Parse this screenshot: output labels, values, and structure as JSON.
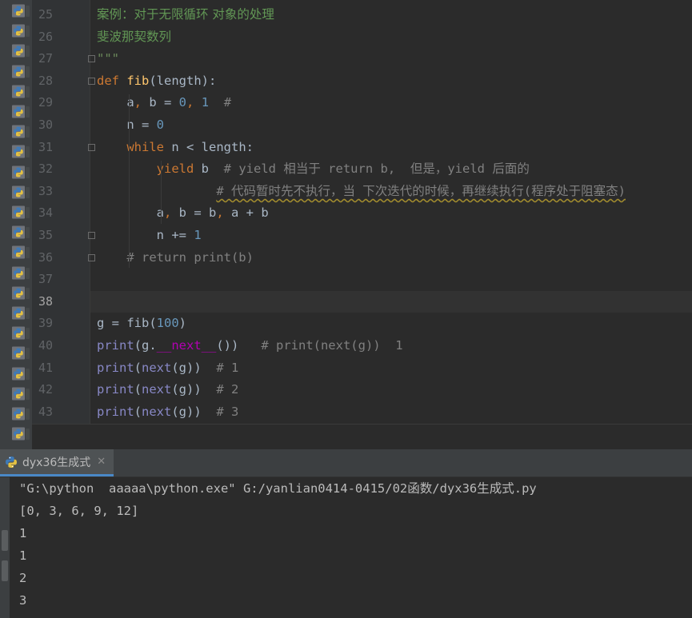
{
  "colors": {
    "editor_bg": "#2b2b2b",
    "gutter_bg": "#313335",
    "keyword": "#cc7832",
    "function": "#ffc66d",
    "number": "#6897bb",
    "comment": "#808080",
    "docstring": "#629755",
    "builtin": "#8888c6",
    "dunder": "#b200b2",
    "text": "#a9b7c6",
    "tab_underline": "#4a88c7"
  },
  "project_panel": {
    "file_icon": "python-file-icon",
    "file_count": 22
  },
  "editor": {
    "current_line": 38,
    "lines": [
      {
        "n": "25",
        "tokens": [
          {
            "c": "t-zh-doc",
            "t": "案例：对于无限循环 对象的处理"
          }
        ]
      },
      {
        "n": "26",
        "tokens": [
          {
            "c": "t-zh-doc",
            "t": "斐波那契数列"
          }
        ]
      },
      {
        "n": "27",
        "tokens": [
          {
            "c": "t-str",
            "t": "\"\"\""
          }
        ]
      },
      {
        "n": "28",
        "tokens": [
          {
            "c": "t-kw",
            "t": "def "
          },
          {
            "c": "t-fn",
            "t": "fib"
          },
          {
            "c": "t-txt",
            "t": "(length):"
          }
        ]
      },
      {
        "n": "29",
        "tokens": [
          {
            "c": "t-txt",
            "t": "    a"
          },
          {
            "c": "t-pun",
            "t": ", "
          },
          {
            "c": "t-txt",
            "t": "b = "
          },
          {
            "c": "t-num",
            "t": "0"
          },
          {
            "c": "t-pun",
            "t": ", "
          },
          {
            "c": "t-num",
            "t": "1"
          },
          {
            "c": "t-cm",
            "t": "  #"
          }
        ]
      },
      {
        "n": "30",
        "tokens": [
          {
            "c": "t-txt",
            "t": "    n = "
          },
          {
            "c": "t-num",
            "t": "0"
          }
        ]
      },
      {
        "n": "31",
        "tokens": [
          {
            "c": "t-txt",
            "t": "    "
          },
          {
            "c": "t-kw",
            "t": "while "
          },
          {
            "c": "t-txt",
            "t": "n < length:"
          }
        ]
      },
      {
        "n": "32",
        "tokens": [
          {
            "c": "t-txt",
            "t": "        "
          },
          {
            "c": "t-kw",
            "t": "yield "
          },
          {
            "c": "t-txt",
            "t": "b"
          },
          {
            "c": "t-cm",
            "t": "  # yield "
          },
          {
            "c": "t-cmz",
            "t": "相当于"
          },
          {
            "c": "t-cm",
            "t": " return b,  "
          },
          {
            "c": "t-cmz",
            "t": "但是，"
          },
          {
            "c": "t-cm",
            "t": "yield "
          },
          {
            "c": "t-cmz",
            "t": "后面的"
          }
        ]
      },
      {
        "n": "33",
        "tokens": [
          {
            "c": "t-txt",
            "t": "                "
          },
          {
            "c": "t-cmz warn-underline",
            "t": "# 代码暂时先不执行，当 下次迭代的时候，再继续执行(程序处于阻塞态)"
          }
        ]
      },
      {
        "n": "34",
        "tokens": [
          {
            "c": "t-txt",
            "t": "        a"
          },
          {
            "c": "t-pun",
            "t": ", "
          },
          {
            "c": "t-txt",
            "t": "b = b"
          },
          {
            "c": "t-pun",
            "t": ", "
          },
          {
            "c": "t-txt",
            "t": "a + b"
          }
        ]
      },
      {
        "n": "35",
        "tokens": [
          {
            "c": "t-txt",
            "t": "        n += "
          },
          {
            "c": "t-num",
            "t": "1"
          }
        ]
      },
      {
        "n": "36",
        "tokens": [
          {
            "c": "t-cm",
            "t": "    # return print(b)"
          }
        ]
      },
      {
        "n": "37",
        "tokens": []
      },
      {
        "n": "38",
        "tokens": []
      },
      {
        "n": "39",
        "tokens": [
          {
            "c": "t-txt",
            "t": "g = fib("
          },
          {
            "c": "t-num",
            "t": "100"
          },
          {
            "c": "t-txt",
            "t": ")"
          }
        ]
      },
      {
        "n": "40",
        "tokens": [
          {
            "c": "t-bi",
            "t": "print"
          },
          {
            "c": "t-txt",
            "t": "(g."
          },
          {
            "c": "t-dunder",
            "t": "__next__"
          },
          {
            "c": "t-txt",
            "t": "())"
          },
          {
            "c": "t-cm",
            "t": "   # print(next(g))  1"
          }
        ]
      },
      {
        "n": "41",
        "tokens": [
          {
            "c": "t-bi",
            "t": "print"
          },
          {
            "c": "t-txt",
            "t": "("
          },
          {
            "c": "t-bi",
            "t": "next"
          },
          {
            "c": "t-txt",
            "t": "(g))"
          },
          {
            "c": "t-cm",
            "t": "  # 1"
          }
        ]
      },
      {
        "n": "42",
        "tokens": [
          {
            "c": "t-bi",
            "t": "print"
          },
          {
            "c": "t-txt",
            "t": "("
          },
          {
            "c": "t-bi",
            "t": "next"
          },
          {
            "c": "t-txt",
            "t": "(g))"
          },
          {
            "c": "t-cm",
            "t": "  # 2"
          }
        ]
      },
      {
        "n": "43",
        "tokens": [
          {
            "c": "t-bi",
            "t": "print"
          },
          {
            "c": "t-txt",
            "t": "("
          },
          {
            "c": "t-bi",
            "t": "next"
          },
          {
            "c": "t-txt",
            "t": "(g))"
          },
          {
            "c": "t-cm",
            "t": "  # 3"
          }
        ]
      }
    ],
    "fold_markers": [
      "27",
      "28",
      "31",
      "35",
      "36"
    ]
  },
  "run_panel": {
    "tab_label": "dyx36生成式",
    "tab_icon": "python-run-icon",
    "close_icon": "close-icon",
    "output": [
      "\"G:\\python  aaaaa\\python.exe\" G:/yanlian0414-0415/02函数/dyx36生成式.py",
      "[0, 3, 6, 9, 12]",
      "1",
      "1",
      "2",
      "3"
    ]
  }
}
